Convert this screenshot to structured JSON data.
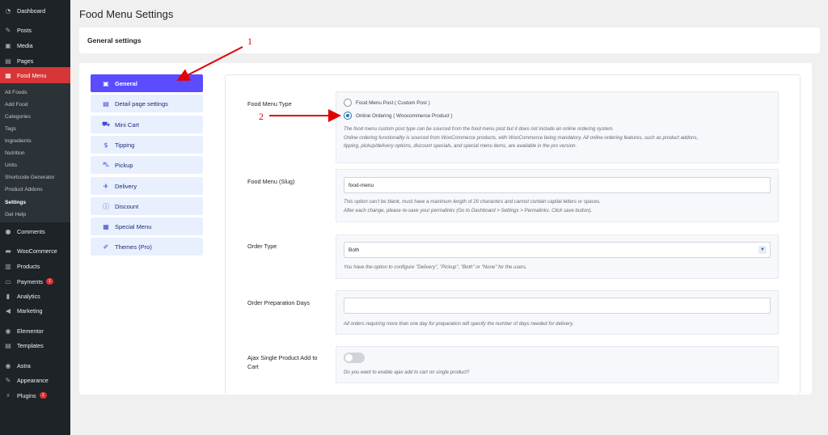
{
  "sidebar": {
    "items": [
      {
        "label": "Dashboard",
        "icon": "dashboard-icon"
      },
      {
        "label": "Posts",
        "icon": "pin-icon"
      },
      {
        "label": "Media",
        "icon": "media-icon"
      },
      {
        "label": "Pages",
        "icon": "pages-icon"
      },
      {
        "label": "Food Menu",
        "icon": "food-menu-icon"
      },
      {
        "label": "Comments",
        "icon": "comments-icon"
      },
      {
        "label": "WooCommerce",
        "icon": "woocommerce-icon"
      },
      {
        "label": "Products",
        "icon": "products-icon"
      },
      {
        "label": "Payments",
        "icon": "payments-icon",
        "badge": "1"
      },
      {
        "label": "Analytics",
        "icon": "analytics-icon"
      },
      {
        "label": "Marketing",
        "icon": "marketing-icon"
      },
      {
        "label": "Elementor",
        "icon": "elementor-icon"
      },
      {
        "label": "Templates",
        "icon": "templates-icon"
      },
      {
        "label": "Astra",
        "icon": "astra-icon"
      },
      {
        "label": "Appearance",
        "icon": "appearance-icon"
      },
      {
        "label": "Plugins",
        "icon": "plugins-icon",
        "badge": "1"
      }
    ],
    "submenu": [
      "All Foods",
      "Add Food",
      "Categories",
      "Tags",
      "Ingredients",
      "Nutrition",
      "Units",
      "Shortcode Generator",
      "Product Addons",
      "Settings",
      "Get Help"
    ]
  },
  "page": {
    "title": "Food Menu Settings",
    "section_title": "General settings"
  },
  "tabs": [
    {
      "label": "General",
      "icon": "general-icon"
    },
    {
      "label": "Detail page settings",
      "icon": "document-icon"
    },
    {
      "label": "Mini Cart",
      "icon": "cart-icon"
    },
    {
      "label": "Tipping",
      "icon": "dollar-icon"
    },
    {
      "label": "Pickup",
      "icon": "car-icon"
    },
    {
      "label": "Delivery",
      "icon": "plane-icon"
    },
    {
      "label": "Discount",
      "icon": "info-icon"
    },
    {
      "label": "Special Menu",
      "icon": "table-icon"
    },
    {
      "label": "Themes (Pro)",
      "icon": "paint-icon"
    }
  ],
  "settings": {
    "food_menu_type": {
      "label": "Food Menu Type",
      "option_1": "Food Menu Post ( Custom Post )",
      "option_2": "Online Ordering ( Woocommerce Product )",
      "desc_1": "The food menu custom post type can be sourced from the food menu post but it does not include an online ordering system.",
      "desc_2": "Online ordering functionality is sourced from WooCommerce products, with WooCommerce being mandatory. All online ordering features, such as product addons,",
      "desc_3": "tipping, pickup/delivery options, discount specials, and special menu items, are available in the pro version."
    },
    "slug": {
      "label": "Food Menu (Slug)",
      "value": "food-menu",
      "desc_1": "This option can't be blank, must have a maximum length of 20 characters and cannot contain capital letters or spaces.",
      "desc_2": "After each change, please re-save your permalinks (Go to Dashboard > Settings > Permalinks. Click save button)."
    },
    "order_type": {
      "label": "Order Type",
      "value": "Both",
      "desc": "You have the option to configure \"Delivery\", \"Pickup\", \"Both\" or \"None\" for the users."
    },
    "prep_days": {
      "label": "Order Preparation Days",
      "value": "",
      "desc": "All orders requiring more than one day for preparation will specify the number of days needed for delivery."
    },
    "ajax": {
      "label": "Ajax Single Product Add to Cart",
      "desc": "Do you want to enable ajax add to cart on single product?"
    }
  },
  "annotations": {
    "one": "1",
    "two": "2"
  },
  "colors": {
    "accent": "#5b4cff",
    "admin_bar": "#1d2327",
    "current_menu": "#d63638",
    "annotation": "#e00000"
  }
}
